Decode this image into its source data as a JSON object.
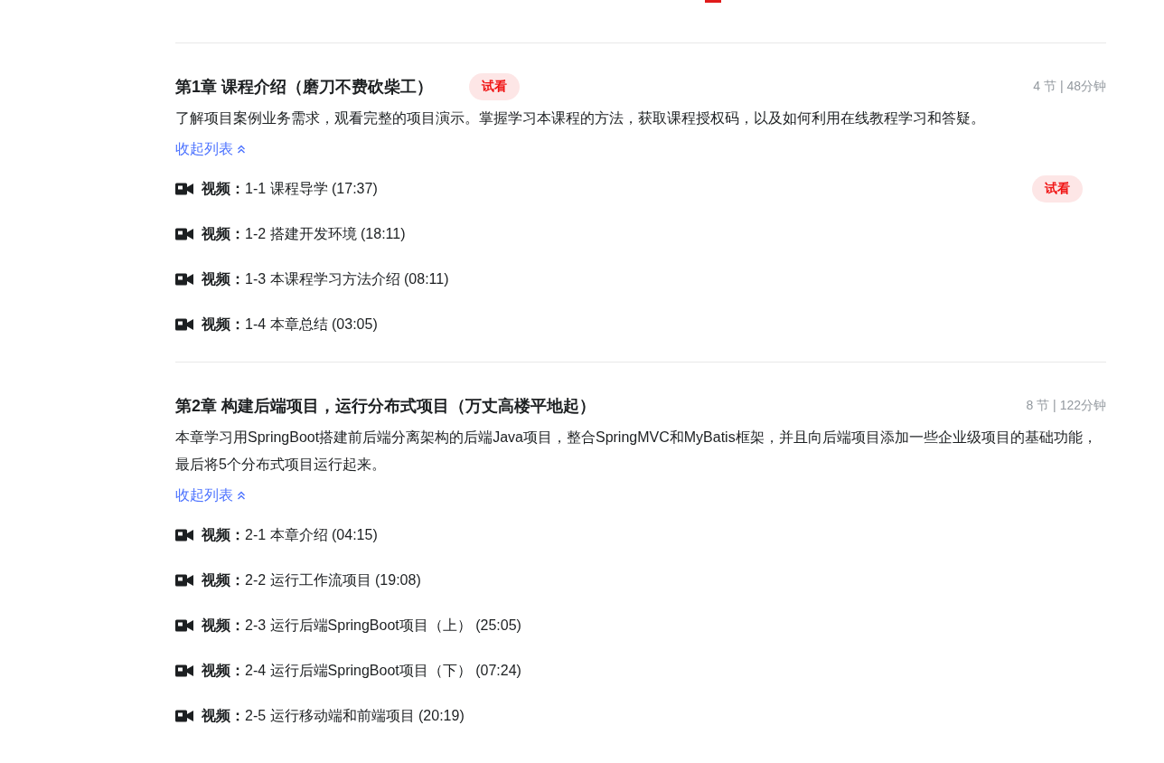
{
  "chapters": [
    {
      "title": "第1章 课程介绍（磨刀不费砍柴工）",
      "badge": "试看",
      "meta": "4 节 | 48分钟",
      "description": "了解项目案例业务需求，观看完整的项目演示。掌握学习本课程的方法，获取课程授权码，以及如何利用在线教程学习和答疑。",
      "toggle": "收起列表",
      "expanded": true,
      "lessons": [
        {
          "text": "**视频：**1-1 课程导学 (17:37)",
          "badge": "试看"
        },
        {
          "text": "**视频：**1-2 搭建开发环境 (18:11)"
        },
        {
          "text": "**视频：**1-3 本课程学习方法介绍 (08:11)"
        },
        {
          "text": "**视频：**1-4 本章总结 (03:05)"
        }
      ]
    },
    {
      "title": "第2章 构建后端项目，运行分布式项目（万丈高楼平地起）",
      "meta": "8 节 | 122分钟",
      "description": "本章学习用SpringBoot搭建前后端分离架构的后端Java项目，整合SpringMVC和MyBatis框架，并且向后端项目添加一些企业级项目的基础功能，最后将5个分布式项目运行起来。",
      "toggle": "收起列表",
      "expanded": true,
      "lessons": [
        {
          "text": "**视频：**2-1 本章介绍 (04:15)"
        },
        {
          "text": "**视频：**2-2 运行工作流项目 (19:08)"
        },
        {
          "text": "**视频：**2-3 运行后端SpringBoot项目（上） (25:05)"
        },
        {
          "text": "**视频：**2-4 运行后端SpringBoot项目（下） (07:24)"
        },
        {
          "text": "**视频：**2-5 运行移动端和前端项目 (20:19)"
        }
      ]
    }
  ]
}
